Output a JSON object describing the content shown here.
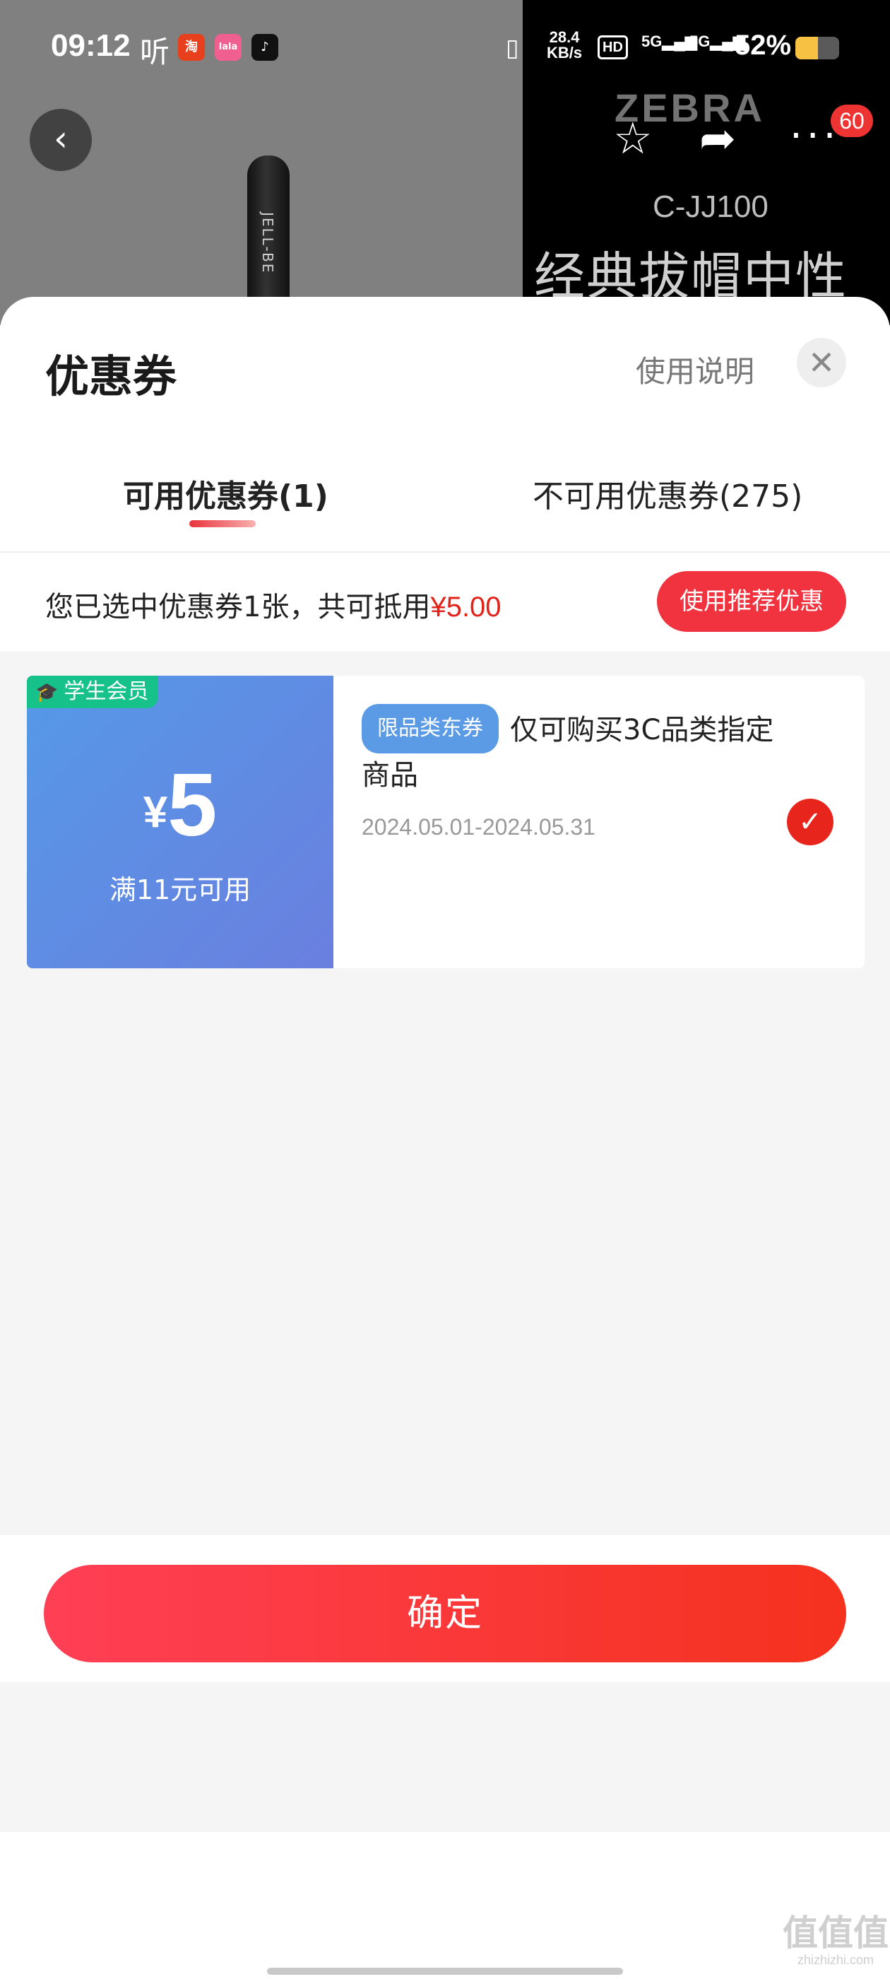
{
  "status_bar": {
    "time": "09:12",
    "listen": "听",
    "apps": [
      {
        "name": "taobao-app-icon",
        "glyph": "淘",
        "color": "#e8401c"
      },
      {
        "name": "lalaka-app-icon",
        "glyph": "lala",
        "color": "#ef5f8f"
      },
      {
        "name": "tiktok-app-icon",
        "glyph": "♪",
        "color": "#111111"
      }
    ],
    "speed_top": "28.4",
    "speed_bottom": "KB/s",
    "hd": "HD",
    "sim1": "5G",
    "sim2": "5G",
    "battery_percent": "52%",
    "battery_level": 0.52
  },
  "product_bg": {
    "brand": "ZEBRA",
    "model": "C-JJ100",
    "subtitle": "经典拔帽中性笔",
    "pen_text": "JELL-BE"
  },
  "top_nav": {
    "back_glyph": "‹",
    "star_glyph": "☆",
    "share_glyph": "➦",
    "more_glyph": "···",
    "badge": "60"
  },
  "sheet": {
    "title": "优惠券",
    "help": "使用说明",
    "close_glyph": "✕",
    "tabs": [
      {
        "label": "可用优惠券(1)",
        "active": true
      },
      {
        "label": "不可用优惠券(275)",
        "active": false
      }
    ],
    "summary_prefix": "您已选中优惠券1张，共可抵用",
    "summary_amount": "¥5.00",
    "recommend_button": "使用推荐优惠",
    "coupon": {
      "member_tag": "学生会员",
      "currency": "¥",
      "amount": "5",
      "condition": "满11元可用",
      "scope_tag": "限品类东券",
      "description": "仅可购买3C品类指定商品",
      "date_range": "2024.05.01-2024.05.31",
      "selected": true
    },
    "confirm_button": "确定"
  },
  "watermark": {
    "main": "值值值",
    "url": "zhizhizhi.com"
  }
}
